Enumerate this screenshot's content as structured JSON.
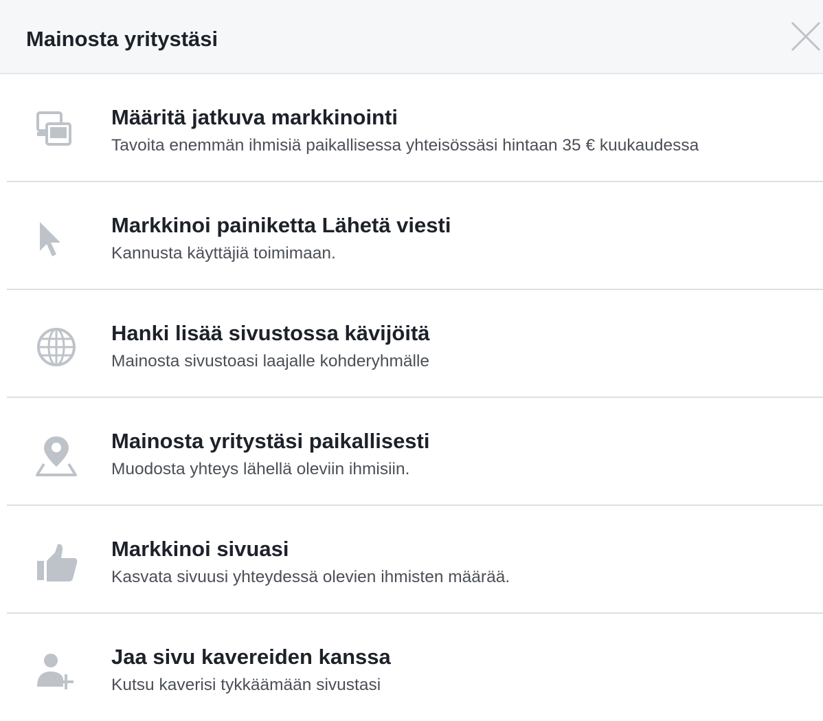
{
  "dialog": {
    "title": "Mainosta yritystäsi",
    "close_icon": "close-icon"
  },
  "colors": {
    "header_bg": "#f6f7f9",
    "text_primary": "#1d2129",
    "text_secondary": "#4b4f56",
    "icon_gray": "#bec2c9",
    "divider": "#dddfe2"
  },
  "options": [
    {
      "icon": "devices-icon",
      "title": "Määritä jatkuva markkinointi",
      "description": "Tavoita enemmän ihmisiä paikallisessa yhteisössäsi hintaan 35 € kuukaudessa"
    },
    {
      "icon": "cursor-icon",
      "title": "Markkinoi painiketta Lähetä viesti",
      "description": "Kannusta käyttäjiä toimimaan."
    },
    {
      "icon": "globe-icon",
      "title": "Hanki lisää sivustossa kävijöitä",
      "description": "Mainosta sivustoasi laajalle kohderyhmälle"
    },
    {
      "icon": "map-pin-icon",
      "title": "Mainosta yritystäsi paikallisesti",
      "description": "Muodosta yhteys lähellä oleviin ihmisiin."
    },
    {
      "icon": "thumbs-up-icon",
      "title": "Markkinoi sivuasi",
      "description": "Kasvata sivuusi yhteydessä olevien ihmisten määrää."
    },
    {
      "icon": "add-friend-icon",
      "title": "Jaa sivu kavereiden kanssa",
      "description": "Kutsu kaverisi tykkäämään sivustasi"
    }
  ]
}
